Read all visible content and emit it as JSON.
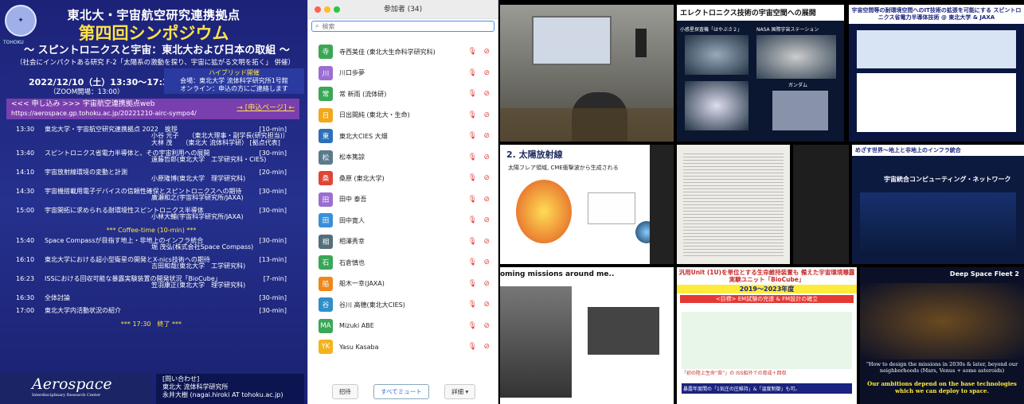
{
  "poster": {
    "logo_text": "TOHOKU",
    "title_org": "東北大・宇宙航空研究連携拠点",
    "title_main": "第四回シンポジウム",
    "subtitle": "～ スピントロニクスと宇宙：東北大および日本の取組 ～",
    "cosponsor": "（社会にインパクトある研究 F-2「太陽系の激動を探り、宇宙に拡がる文明を拓く」 併催）",
    "date": "2022/12/10（土）13:30～17:30",
    "zoom_open": "（ZOOM開場：13:00）",
    "hybrid_1": "ハイブリッド開催",
    "hybrid_2": "会場：東北大学 流体科学研究所1号館",
    "hybrid_3": "オンライン：申込の方にご連絡します",
    "register_label": "<<< 申し込み >>>  宇宙航空連携拠点web",
    "register_url": "https://aerospace.gp.tohoku.ac.jp/20221210-airc-sympo4/",
    "register_button": "→ [申込ページ] ←",
    "program": [
      {
        "time": "13:30",
        "title": "東北大学・宇宙航空研究連携拠点 2022　挨拶",
        "dur": "[10-min]",
        "speaker": "小谷 元子　　（東北大理事・副学長(研究担当)）",
        "speaker2": "大林 茂　　（東北大 流体科学研） [拠点代表]"
      },
      {
        "time": "13:40",
        "title": "スピントロニクス省電力半導体と、その宇宙利用への展開",
        "dur": "[30-min]",
        "speaker": "遠藤哲郎(東北大学　工学研究科・CIES)"
      },
      {
        "time": "14:10",
        "title": "宇宙放射線環境の変動と計測",
        "dur": "[20-min]",
        "speaker": "小原隆博(東北大学　理学研究科)"
      },
      {
        "time": "14:30",
        "title": "宇宙機搭載用電子デバイスの信頼性確保とスピントロニクスへの期待",
        "dur": "[30-min]",
        "speaker": "廣瀬和之(宇宙科学研究所/JAXA)"
      },
      {
        "time": "15:00",
        "title": "宇宙開拓に求められる耐環境性スピントロニクス半導体",
        "dur": "[30-min]",
        "speaker": "小林大輔(宇宙科学研究所/JAXA)"
      }
    ],
    "coffee": "*** Coffee-time (10-min) ***",
    "program2": [
      {
        "time": "15:40",
        "title": "Space Compassが目指す地上・非地上のインフラ統合",
        "dur": "[30-min]",
        "speaker": "堀 茂弘(株式会社Space Compass)"
      },
      {
        "time": "16:10",
        "title": "東北大学における超小型衛星の開発とX-nics技術への期待",
        "dur": "[13-min]",
        "speaker": "吉田和哉(東北大学　工学研究科)"
      },
      {
        "time": "16:23",
        "title": "ISSにおける回収可能な暴露実験装置の開発状況「BioCube」",
        "dur": "[7-min]",
        "speaker": "笠羽康正(東北大学　理学研究科)"
      },
      {
        "time": "16:30",
        "title": "全体討論",
        "dur": "[30-min]",
        "speaker": ""
      },
      {
        "time": "17:00",
        "title": "東北大学内活動状況の紹介",
        "dur": "[30-min]",
        "speaker": ""
      }
    ],
    "end": "*** 17:30　終了 ***",
    "aero_brand": "Aerospace",
    "aero_sub": "Interdisciplinary Research Center",
    "contact_1": "[問い合わせ]",
    "contact_2": "東北大 流体科学研究所",
    "contact_3": "永井大樹 (nagai.hiroki AT tohoku.ac.jp)"
  },
  "zoom": {
    "title": "参加者 (34)",
    "search_placeholder": "検索",
    "participants": [
      {
        "initial": "寺",
        "name": "寺西美佳 (東北大生命科学研究科)",
        "color": "#3aa757"
      },
      {
        "initial": "川",
        "name": "川口歩夢",
        "color": "#9b6fd0"
      },
      {
        "initial": "常",
        "name": "常 新雨 (流体研)",
        "color": "#3aa757"
      },
      {
        "initial": "日",
        "name": "日出間純 (東北大・生命)",
        "color": "#f2a81d"
      },
      {
        "initial": "東",
        "name": "東北大CIES 大畑",
        "color": "#2f6fb8"
      },
      {
        "initial": "松",
        "name": "松本篤諒",
        "color": "#5a7b8c"
      },
      {
        "initial": "桑",
        "name": "桑原 (東北大学)",
        "color": "#e04535"
      },
      {
        "initial": "田",
        "name": "田中 泰吾",
        "color": "#9b6fd0"
      },
      {
        "initial": "田",
        "name": "田中寛人",
        "color": "#3a8fd8"
      },
      {
        "initial": "相",
        "name": "相澤秀幸",
        "color": "#546e7a"
      },
      {
        "initial": "石",
        "name": "石倉慎也",
        "color": "#3aa757"
      },
      {
        "initial": "船",
        "name": "船木一幸(JAXA)",
        "color": "#f0871a"
      },
      {
        "initial": "谷",
        "name": "谷川 高穂(東北大CIES)",
        "color": "#2f8fc8"
      },
      {
        "initial": "MA",
        "name": "Mizuki ABE",
        "color": "#3aa757"
      },
      {
        "initial": "YK",
        "name": "Yasu Kasaba",
        "color": "#f2b41d"
      }
    ],
    "invite": "招待",
    "mute_all": "すべてミュート",
    "more": "詳細"
  },
  "slides": {
    "s1_title": "エレクトロニクス技術の宇宙空間への展開",
    "s1_l1": "小惑星探査機「はやぶさ２」",
    "s1_l2": "NASA 国際宇宙ステーション",
    "s1_l3": "ガンダム",
    "s2_title": "宇宙空間等の耐環境空間へのIT技術の拡張を可能にする スピントロニクス省電力半導体技術 @ 東北大学 & JAXA",
    "s3_title": "2. 太陽放射線",
    "s3_sub": "太陽フレア領域, CME衝撃波から生成される",
    "s4_title": "めざす世界～地上と非地上のインフラ統合",
    "s4_sub": "宇宙統合コンピューティング・ネットワーク",
    "s5_title": "oming missions around me..",
    "s6_title": "汎用Unit (1U)を単位とする生命維持装置も 備えた宇宙環境曝露実験ユニット「BioCube」",
    "s6_year": "2019～2023年度",
    "s6_goal": "<目標> EM試験の完遂 & FM設計の確立",
    "s6_b1": "「初の陸上生命“苔”」の ISS船外での育成＋回収",
    "s6_b2": "暴露年度間の「1気圧の圧維持」&「温度制御」も可。",
    "s7_title": "Deep Space Fleet 2",
    "s7_q": "\"How to design the missions in 2030s & later, beyond our neighborhoods (Mars, Venus + some asteroids)",
    "s7_q2": "Our ambitions depend on the base technologies which we can deploy to space."
  }
}
